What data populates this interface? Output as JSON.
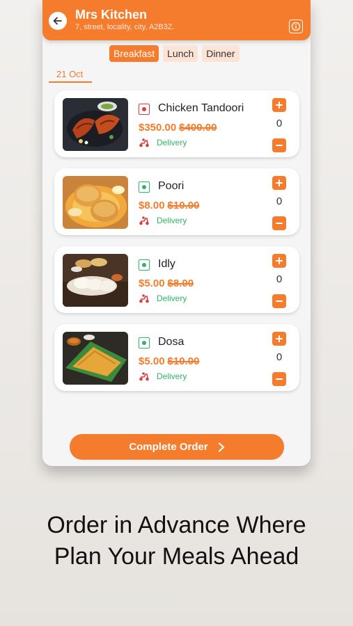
{
  "header": {
    "title": "Mrs Kitchen",
    "address": "7, street, locality, city, A2B3Z.",
    "back_icon": "arrow-left-icon",
    "info_icon": "info-icon"
  },
  "tabs": [
    {
      "label": "Breakfast",
      "active": true
    },
    {
      "label": "Lunch",
      "active": false
    },
    {
      "label": "Dinner",
      "active": false
    }
  ],
  "date": "21 Oct",
  "items": [
    {
      "name": "Chicken Tandoori",
      "type": "non-veg",
      "price": "$350.00",
      "old_price": "$400.00",
      "delivery": "Delivery",
      "qty": "0"
    },
    {
      "name": "Poori",
      "type": "veg",
      "price": "$8.00",
      "old_price": "$10.00",
      "delivery": "Delivery",
      "qty": "0"
    },
    {
      "name": "Idly",
      "type": "veg",
      "price": "$5.00",
      "old_price": "$8.00",
      "delivery": "Delivery",
      "qty": "0"
    },
    {
      "name": "Dosa",
      "type": "veg",
      "price": "$5.00",
      "old_price": "$10.00",
      "delivery": "Delivery",
      "qty": "0"
    }
  ],
  "complete_button": "Complete Order",
  "promo_lines": [
    "Order in Advance Where",
    "Plan Your Meals Ahead"
  ],
  "colors": {
    "accent": "#f47c2c",
    "veg": "#2fb565",
    "non_veg": "#e03b3b"
  }
}
